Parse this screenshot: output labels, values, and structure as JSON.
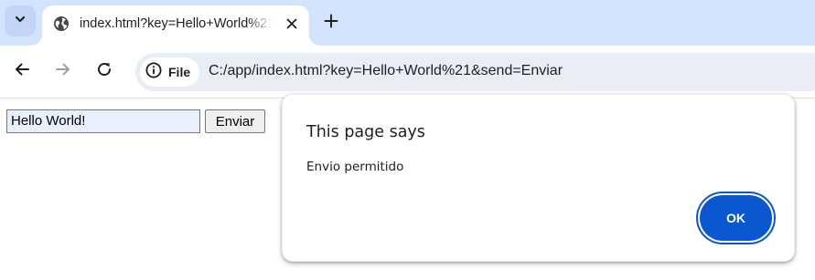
{
  "browser": {
    "tab": {
      "title": "index.html?key=Hello+World%21&send=Enviar"
    },
    "address_bar": {
      "chip_label": "File",
      "url": "C:/app/index.html?key=Hello+World%21&send=Enviar"
    },
    "icons": {
      "tab_search": "chevron-down-icon",
      "favicon": "globe-icon",
      "tab_close": "close-icon",
      "new_tab": "plus-icon",
      "back": "arrow-left-icon",
      "forward": "arrow-right-icon",
      "reload": "reload-icon",
      "site_info": "info-icon"
    },
    "colors": {
      "tabstrip": "#d3e3fd",
      "omnibox": "#e9eef6",
      "accent": "#0b57d0"
    }
  },
  "page": {
    "form": {
      "key_value": "Hello World!",
      "submit_label": "Enviar"
    }
  },
  "dialog": {
    "title": "This page says",
    "message": "Envio permitido",
    "ok_label": "OK"
  }
}
